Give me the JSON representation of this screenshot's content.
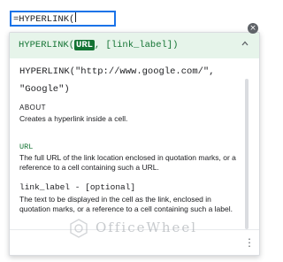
{
  "cell_input": {
    "text": "=HYPERLINK("
  },
  "popup": {
    "signature": {
      "func": "HYPERLINK(",
      "active_arg": "URL",
      "rest": ", [link_label])"
    },
    "example": {
      "line1": "HYPERLINK(\"http://www.google.com/\",",
      "line2": "\"Google\")"
    },
    "about": {
      "heading": "ABOUT",
      "text": "Creates a hyperlink inside a cell."
    },
    "params": [
      {
        "name": "URL",
        "desc": "The full URL of the link location enclosed in quotation marks, or a reference to a cell containing such a URL."
      },
      {
        "name": "link_label - [optional]",
        "desc": "The text to be displayed in the cell as the link, enclosed in quotation marks, or a reference to a cell containing such a label."
      }
    ]
  },
  "watermark": {
    "text": "OfficeWheel"
  },
  "colors": {
    "accent": "#137333",
    "header_bg": "#e6f4ea",
    "focus": "#1a73e8"
  },
  "icons": {
    "close": "close-icon",
    "collapse": "chevron-up-icon",
    "more": "more-vert-icon"
  }
}
